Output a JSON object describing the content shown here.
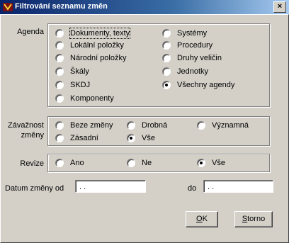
{
  "window": {
    "title": "Filtrování seznamu změn",
    "close_glyph": "×"
  },
  "agenda": {
    "label": "Agenda",
    "options": [
      {
        "label": "Dokumenty, texty",
        "selected": false
      },
      {
        "label": "Lokální položky",
        "selected": false
      },
      {
        "label": "Národní položky",
        "selected": false
      },
      {
        "label": "Škály",
        "selected": false
      },
      {
        "label": "SKDJ",
        "selected": false
      },
      {
        "label": "Komponenty",
        "selected": false
      },
      {
        "label": "Systémy",
        "selected": false
      },
      {
        "label": "Procedury",
        "selected": false
      },
      {
        "label": "Druhy veličin",
        "selected": false
      },
      {
        "label": "Jednotky",
        "selected": false
      },
      {
        "label": "Všechny agendy",
        "selected": true
      }
    ]
  },
  "zavaznost": {
    "label_line1": "Závažnost",
    "label_line2": "změny",
    "options": [
      {
        "label": "Beze změny",
        "selected": false
      },
      {
        "label": "Drobná",
        "selected": false
      },
      {
        "label": "Významná",
        "selected": false
      },
      {
        "label": "Zásadní",
        "selected": false
      },
      {
        "label": "Vše",
        "selected": true
      }
    ]
  },
  "revize": {
    "label": "Revize",
    "options": [
      {
        "label": "Ano",
        "selected": false
      },
      {
        "label": "Ne",
        "selected": false
      },
      {
        "label": "Vše",
        "selected": true
      }
    ]
  },
  "datum": {
    "from_label": "Datum změny od",
    "from_value": " . .",
    "to_label": "do",
    "to_value": " . ."
  },
  "buttons": {
    "ok_mnemonic": "O",
    "ok_rest": "K",
    "storno_mnemonic": "S",
    "storno_rest": "torno"
  }
}
